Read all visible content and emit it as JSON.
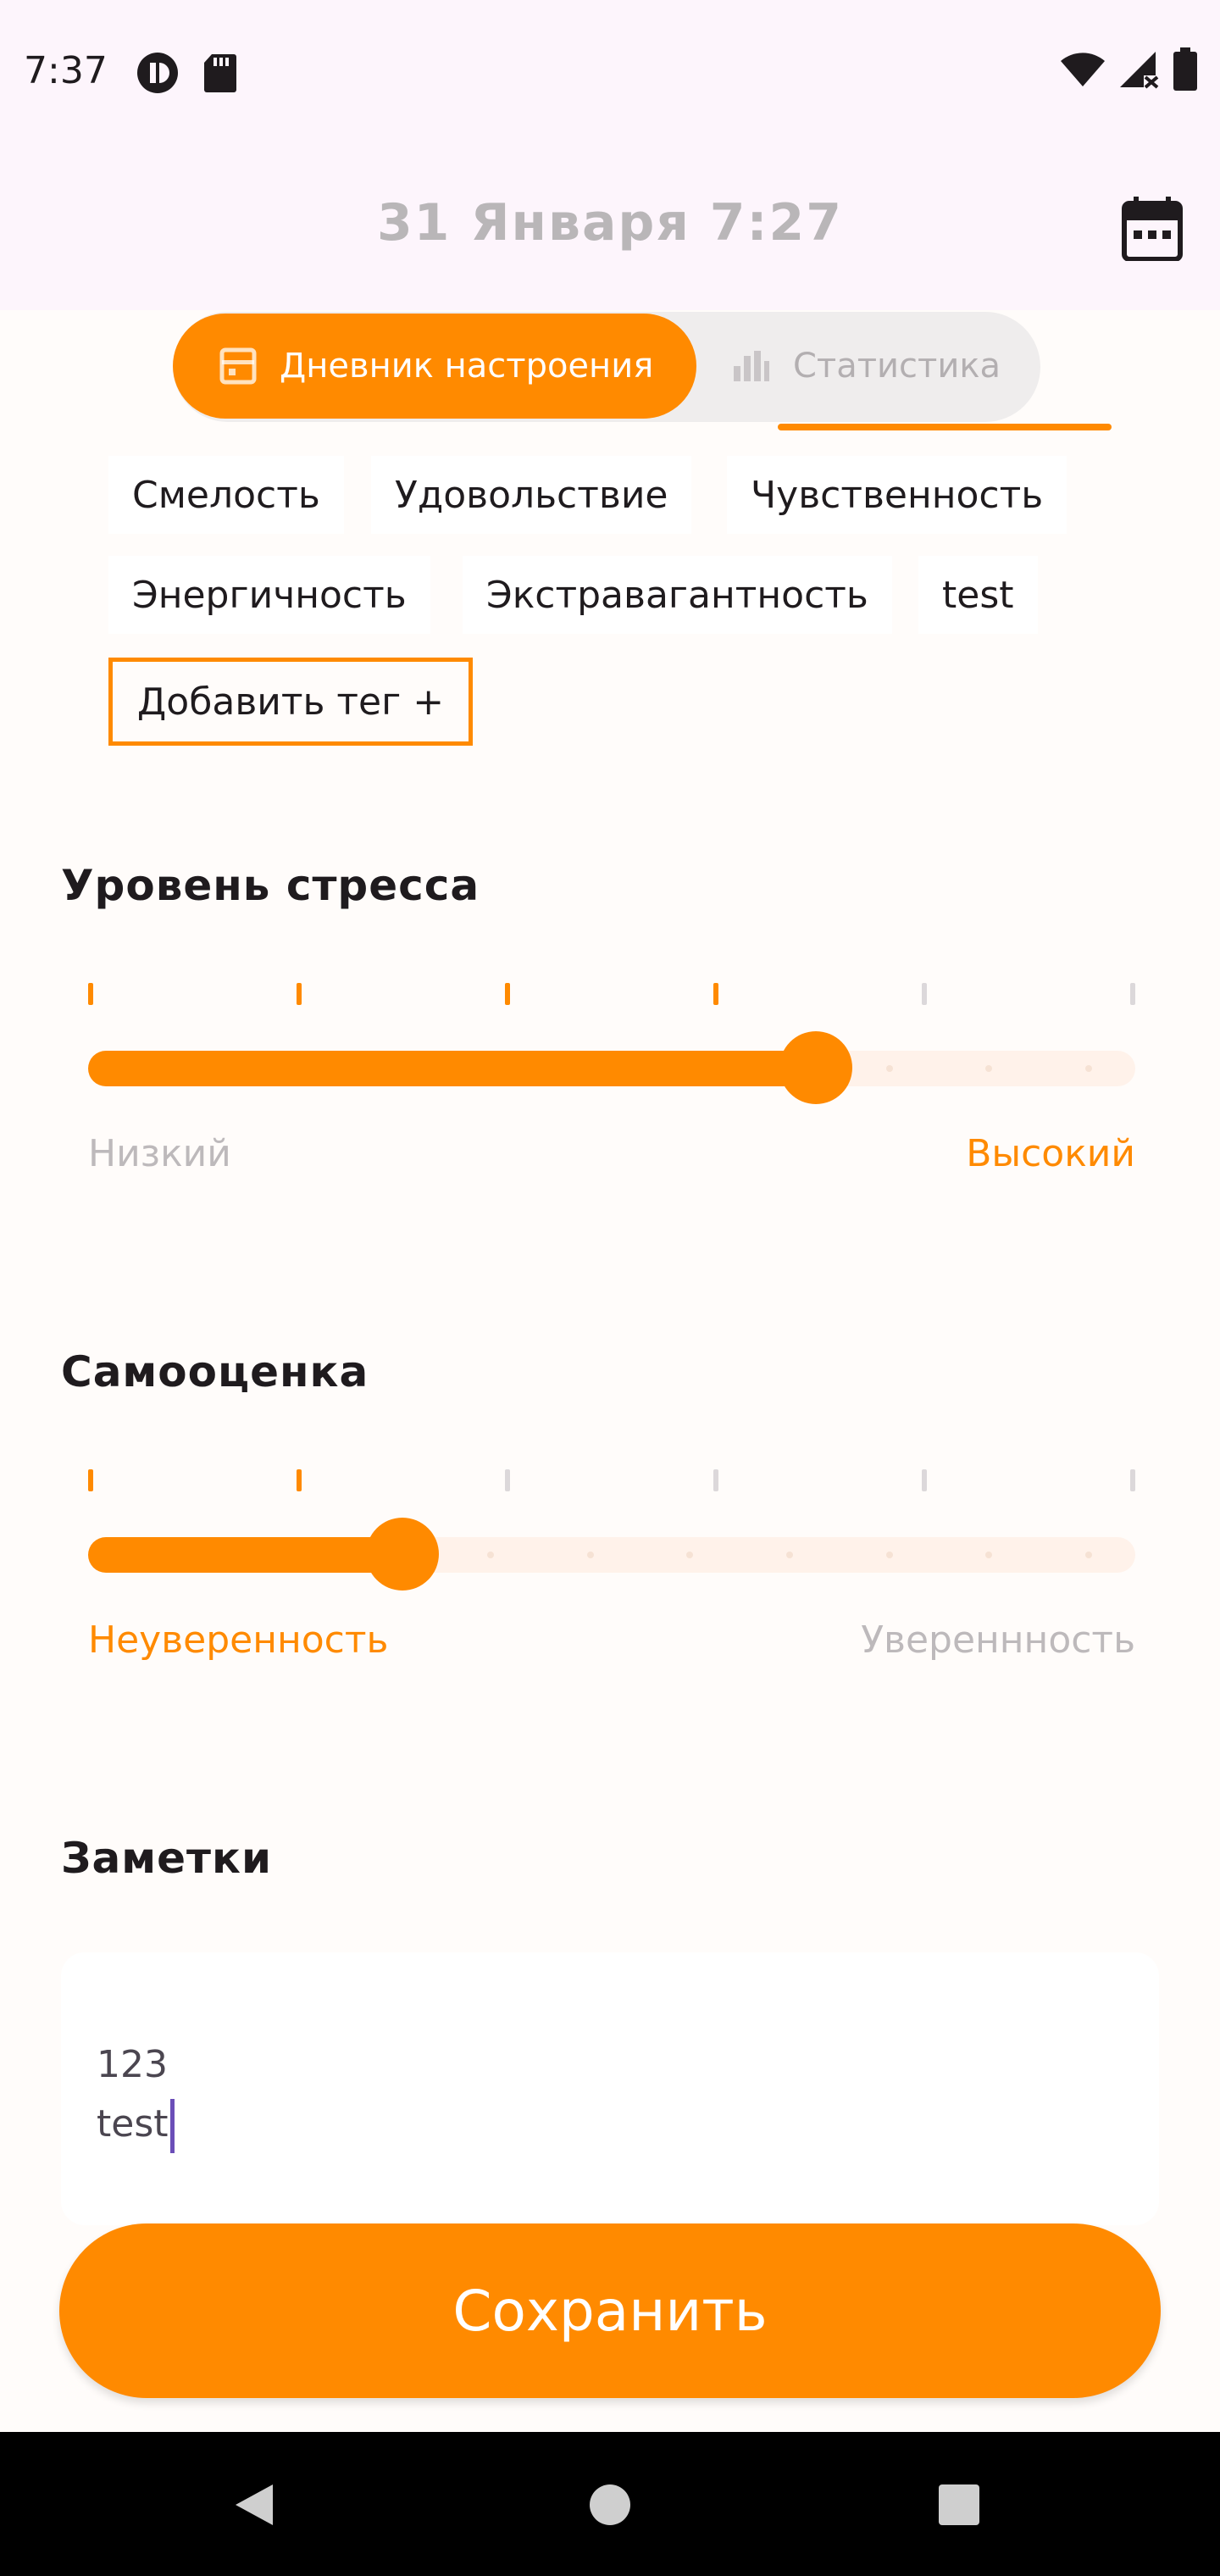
{
  "status_bar": {
    "time": "7:37",
    "left_icons": [
      "pause-circle-icon",
      "sd-card-icon"
    ],
    "right_icons": [
      "wifi-icon",
      "signal-off-icon",
      "battery-icon"
    ]
  },
  "app_bar": {
    "title": "31 Января 7:27",
    "action_icon": "calendar-icon"
  },
  "tabs": [
    {
      "label": "Дневник настроения",
      "icon": "diary-icon",
      "active": true
    },
    {
      "label": "Статистика",
      "icon": "bar-chart-icon",
      "active": false
    }
  ],
  "tags": {
    "items": [
      "Смелость",
      "Удовольствие",
      "Чувственность",
      "Энергичность",
      "Экстравагантность",
      "test"
    ],
    "add_label": "Добавить тег +"
  },
  "stress": {
    "title": "Уровень стресса",
    "value_fraction": 0.695,
    "low_label": "Низкий",
    "high_label": "Высокий"
  },
  "self_esteem": {
    "title": "Самооценка",
    "value_fraction": 0.3,
    "low_label": "Неуверенность",
    "high_label": "Увереннность"
  },
  "notes": {
    "title": "Заметки",
    "lines": [
      "123",
      "test"
    ]
  },
  "save_label": "Сохранить",
  "navigation": [
    "back-icon",
    "home-icon",
    "recents-icon"
  ],
  "colors": {
    "accent": "#ff8a00",
    "inactive_text": "#b3afb1",
    "app_bar_bg": "#fdf5fc"
  }
}
